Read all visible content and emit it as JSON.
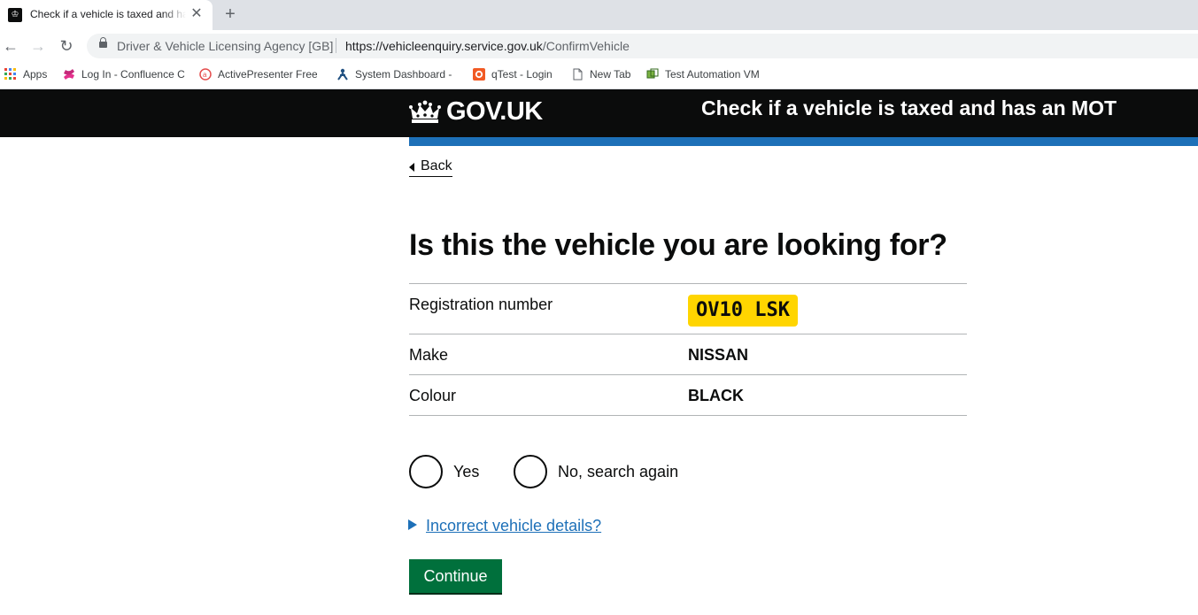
{
  "browser": {
    "tab_title": "Check if a vehicle is taxed and has an MOT",
    "new_tab_symbol": "+",
    "close_symbol": "✕",
    "site_identity": "Driver & Vehicle Licensing Agency [GB]",
    "url_host": "https://vehicleenquiry.service.gov.uk",
    "url_path": "/ConfirmVehicle",
    "bookmarks": [
      {
        "label": "Apps",
        "icon": "apps-grid-icon"
      },
      {
        "label": "Log In - Confluence C",
        "icon": "confluence-icon"
      },
      {
        "label": "ActivePresenter Free",
        "icon": "activepresenter-icon"
      },
      {
        "label": "System Dashboard - J",
        "icon": "jira-icon"
      },
      {
        "label": "qTest - Login",
        "icon": "qtest-icon"
      },
      {
        "label": "New Tab",
        "icon": "page-icon"
      },
      {
        "label": "Test Automation VM",
        "icon": "vm-icon"
      }
    ]
  },
  "header": {
    "logotype": "GOV.UK",
    "service_name": "Check if a vehicle is taxed and has an MOT",
    "brand_black": "#0b0c0c",
    "brand_blue": "#1d70b8"
  },
  "back_link": "Back",
  "page_title": "Is this the vehicle you are looking for?",
  "summary": {
    "registration_label": "Registration number",
    "registration_value": "OV10 LSK",
    "make_label": "Make",
    "make_value": "NISSAN",
    "colour_label": "Colour",
    "colour_value": "BLACK"
  },
  "radios": {
    "yes_label": "Yes",
    "no_label": "No, search again"
  },
  "details_toggle": "Incorrect vehicle details?",
  "continue_label": "Continue",
  "colors": {
    "plate_yellow": "#ffd500",
    "button_green": "#00703c"
  }
}
